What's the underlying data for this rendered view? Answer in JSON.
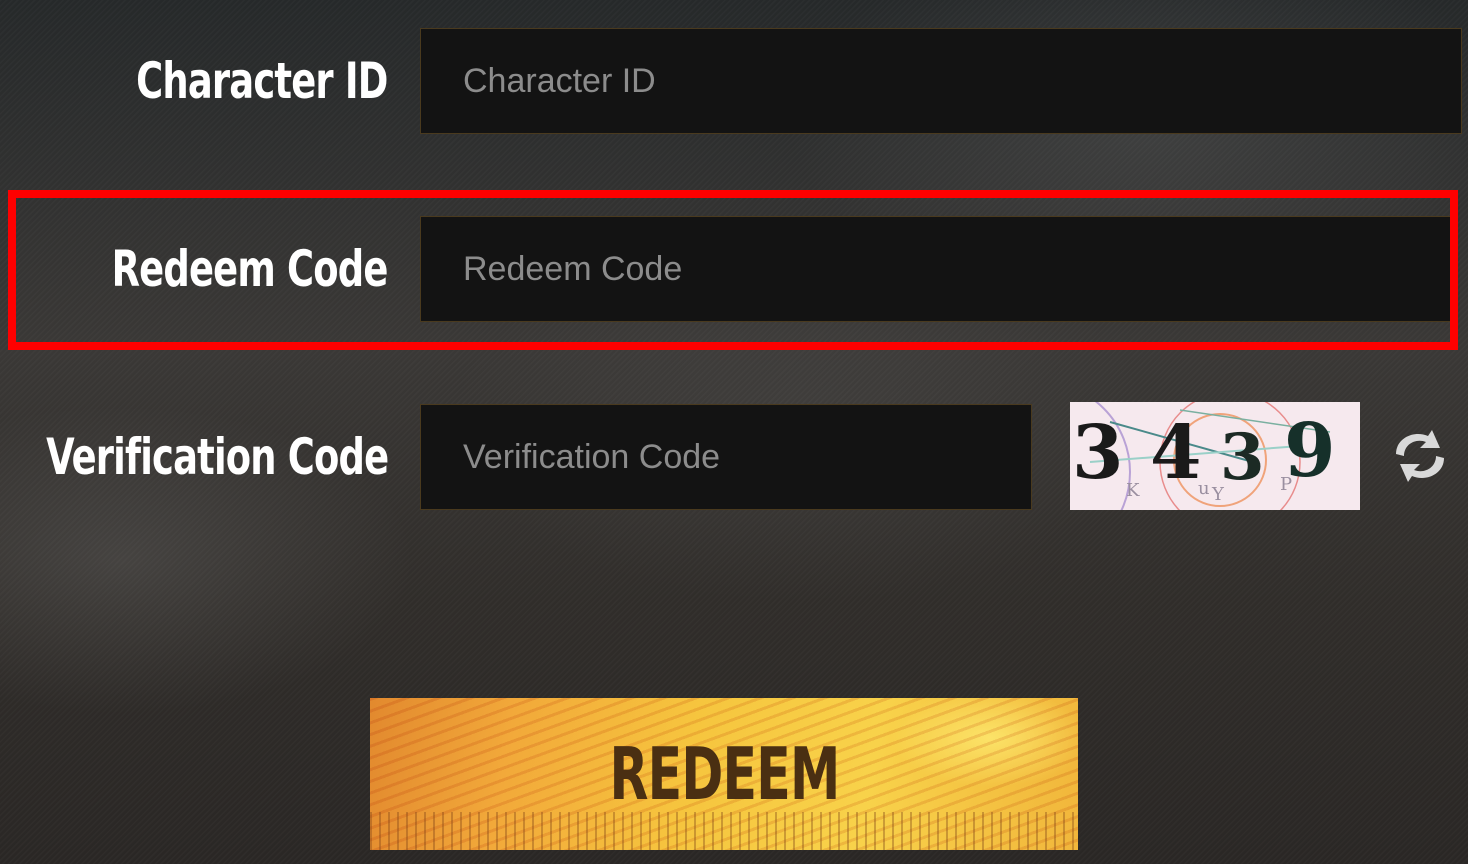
{
  "form": {
    "character_id": {
      "label": "Character ID",
      "placeholder": "Character ID",
      "value": ""
    },
    "redeem_code": {
      "label": "Redeem Code",
      "placeholder": "Redeem Code",
      "value": "",
      "highlighted": true,
      "highlight_color": "#ff0000"
    },
    "verification_code": {
      "label": "Verification Code",
      "placeholder": "Verification Code",
      "value": ""
    },
    "captcha": {
      "digits": [
        "3",
        "4",
        "3",
        "9"
      ]
    },
    "refresh_icon": "refresh-icon",
    "submit": {
      "label": "REDEEM"
    }
  },
  "colors": {
    "input_bg": "#131313",
    "input_border": "#4a3a1e",
    "button_gradient_start": "#e2892e",
    "button_gradient_end": "#f8d24a",
    "button_text": "#4a2f12"
  }
}
